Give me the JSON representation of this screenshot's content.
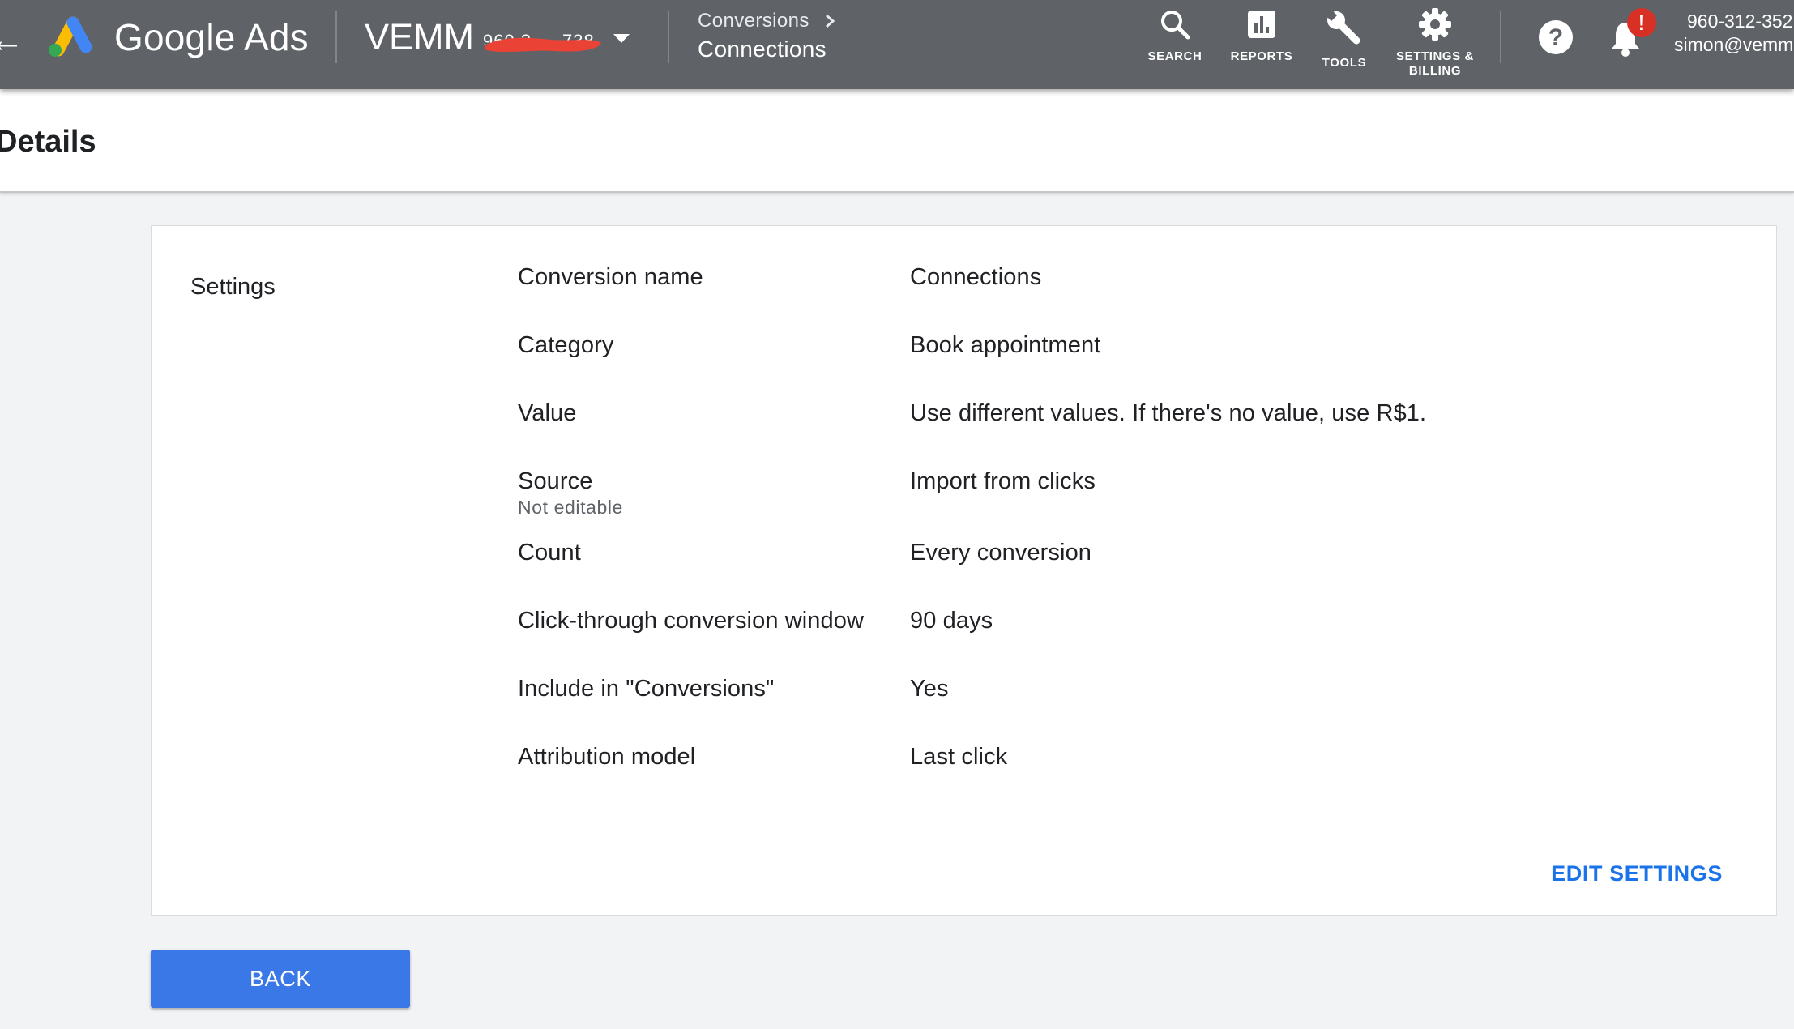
{
  "header": {
    "brand": "Google Ads",
    "account_name": "VEMM",
    "account_id_partial": "960 3 · · 738",
    "breadcrumb_parent": "Conversions",
    "breadcrumb_current": "Connections",
    "nav": {
      "search": "SEARCH",
      "reports": "REPORTS",
      "tools": "TOOLS",
      "settings_line1": "SETTINGS &",
      "settings_line2": "BILLING"
    },
    "notification_badge": "!",
    "account_number": "960-312-352",
    "account_email": "simon@vemm"
  },
  "page": {
    "title": "Details"
  },
  "settings": {
    "section_title": "Settings",
    "rows": [
      {
        "label": "Conversion name",
        "value": "Connections"
      },
      {
        "label": "Category",
        "value": "Book appointment"
      },
      {
        "label": "Value",
        "value": "Use different values. If there's no value, use R$1."
      },
      {
        "label": "Source",
        "sublabel": "Not editable",
        "value": "Import from clicks"
      },
      {
        "label": "Count",
        "value": "Every conversion"
      },
      {
        "label": "Click-through conversion window",
        "value": "90 days"
      },
      {
        "label": "Include in \"Conversions\"",
        "value": "Yes"
      },
      {
        "label": "Attribution model",
        "value": "Last click"
      }
    ],
    "edit_label": "EDIT SETTINGS"
  },
  "footer": {
    "back_label": "BACK"
  },
  "colors": {
    "header_bg": "#5f6368",
    "primary_blue": "#1a73e8",
    "button_blue": "#3b78e7",
    "badge_red": "#d93025",
    "redaction_red": "#ea4335"
  },
  "icons": {
    "logo": "google-ads-logo-icon",
    "search": "search-icon",
    "reports": "bar-chart-icon",
    "tools": "wrench-icon",
    "settings": "gear-icon",
    "help": "help-icon",
    "notifications": "bell-icon"
  }
}
